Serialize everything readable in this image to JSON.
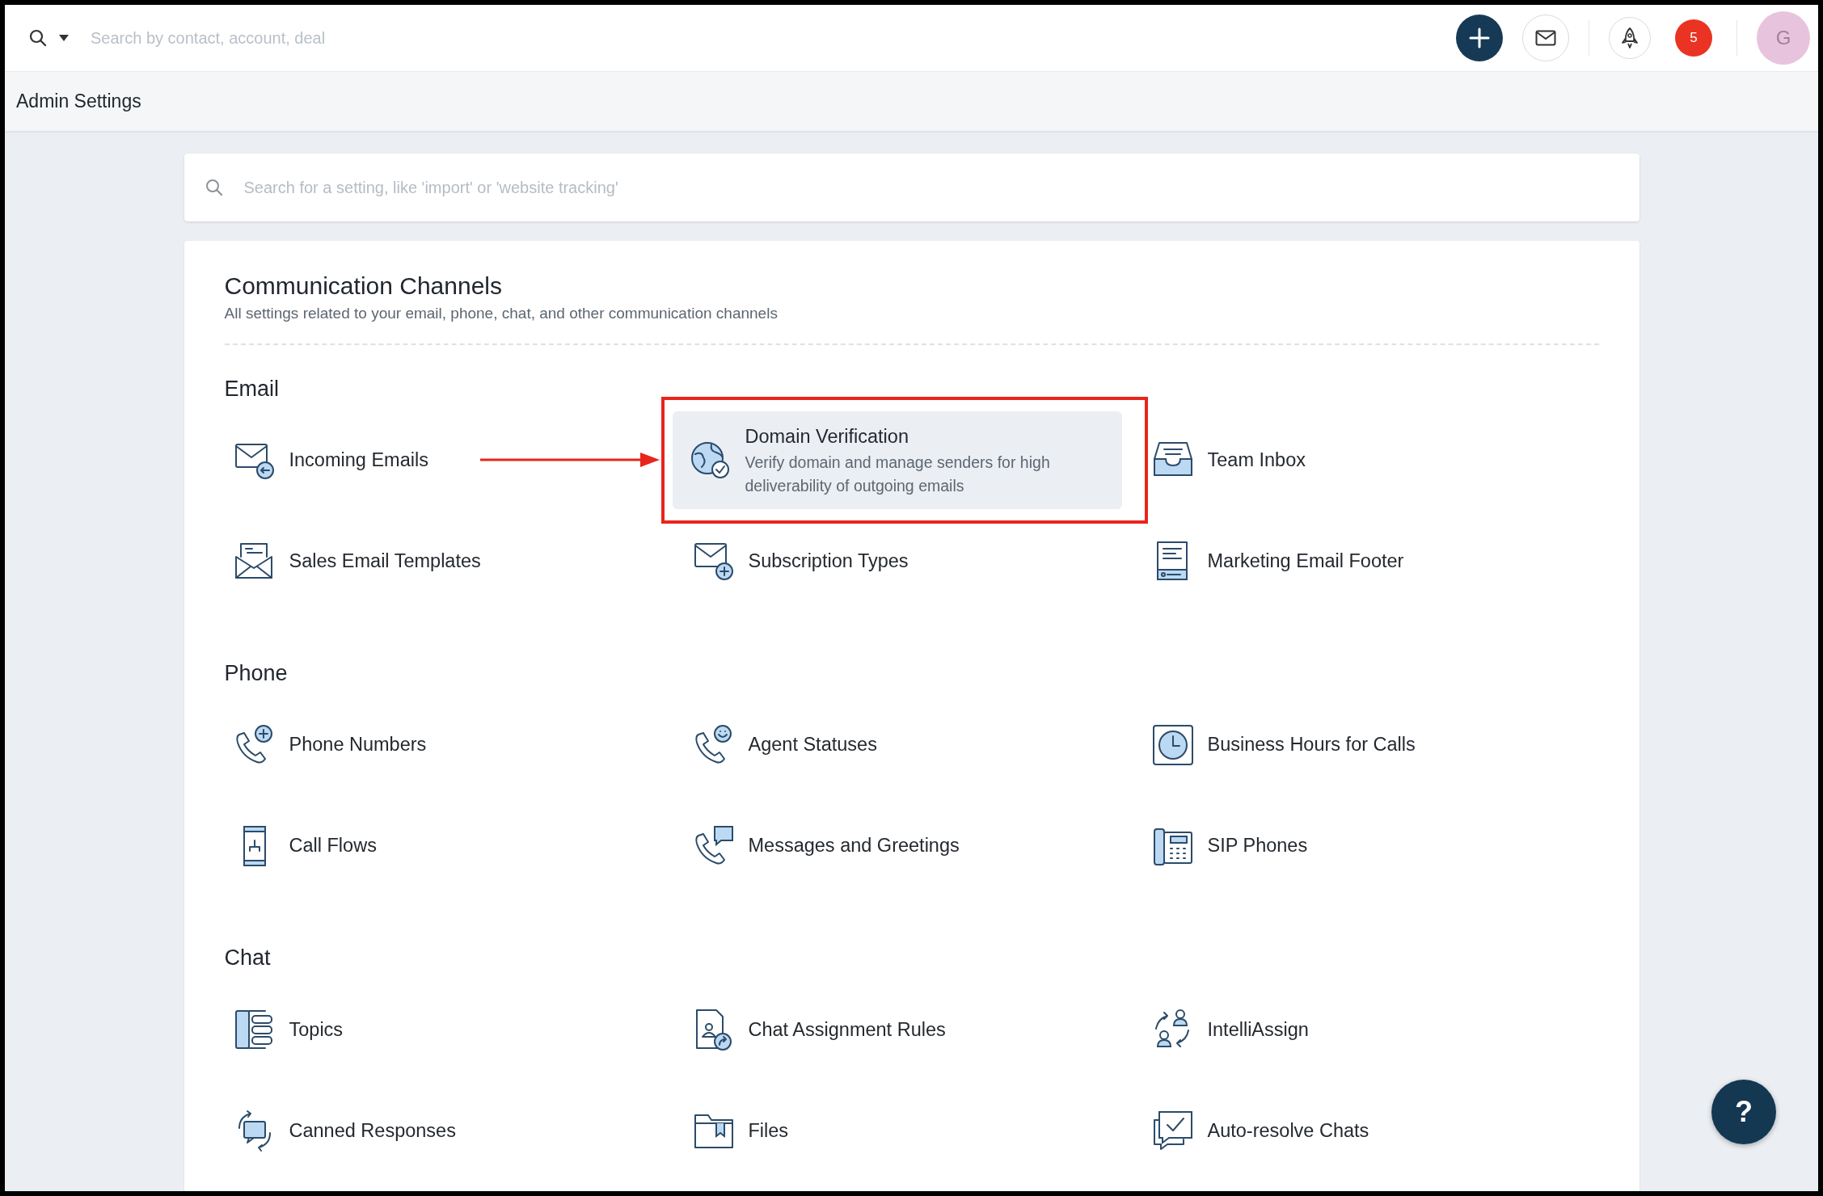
{
  "topbar": {
    "search_placeholder": "Search by contact, account, deal",
    "notification_count": "5",
    "avatar_initial": "G"
  },
  "page_header": {
    "title": "Admin Settings"
  },
  "settings_search": {
    "placeholder": "Search for a setting, like 'import' or 'website tracking'"
  },
  "panel": {
    "title": "Communication Channels",
    "subtitle": "All settings related to your email, phone, chat, and other communication channels",
    "sections": [
      {
        "title": "Email",
        "items": [
          {
            "label": "Incoming Emails",
            "highlighted": false,
            "annotated": false
          },
          {
            "label": "Domain Verification",
            "description": "Verify domain and manage senders for high deliverability of outgoing emails",
            "highlighted": true,
            "annotated": true
          },
          {
            "label": "Team Inbox",
            "highlighted": false,
            "annotated": false
          },
          {
            "label": "Sales Email Templates",
            "highlighted": false,
            "annotated": false
          },
          {
            "label": "Subscription Types",
            "highlighted": false,
            "annotated": false
          },
          {
            "label": "Marketing Email Footer",
            "highlighted": false,
            "annotated": false
          }
        ]
      },
      {
        "title": "Phone",
        "items": [
          {
            "label": "Phone Numbers",
            "highlighted": false,
            "annotated": false
          },
          {
            "label": "Agent Statuses",
            "highlighted": false,
            "annotated": false
          },
          {
            "label": "Business Hours for Calls",
            "highlighted": false,
            "annotated": false
          },
          {
            "label": "Call Flows",
            "highlighted": false,
            "annotated": false
          },
          {
            "label": "Messages and Greetings",
            "highlighted": false,
            "annotated": false
          },
          {
            "label": "SIP Phones",
            "highlighted": false,
            "annotated": false
          }
        ]
      },
      {
        "title": "Chat",
        "items": [
          {
            "label": "Topics",
            "highlighted": false,
            "annotated": false
          },
          {
            "label": "Chat Assignment Rules",
            "highlighted": false,
            "annotated": false
          },
          {
            "label": "IntelliAssign",
            "highlighted": false,
            "annotated": false
          },
          {
            "label": "Canned Responses",
            "highlighted": false,
            "annotated": false
          },
          {
            "label": "Files",
            "highlighted": false,
            "annotated": false
          },
          {
            "label": "Auto-resolve Chats",
            "highlighted": false,
            "annotated": false
          }
        ]
      }
    ]
  },
  "help_button": {
    "label": "?"
  }
}
